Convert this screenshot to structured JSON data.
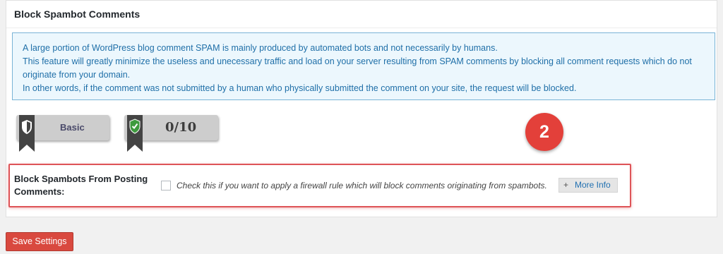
{
  "panel": {
    "title": "Block Spambot Comments",
    "info_lines": [
      "A large portion of WordPress blog comment SPAM is mainly produced by automated bots and not necessarily by humans.",
      "This feature will greatly minimize the useless and unecessary traffic and load on your server resulting from SPAM comments by blocking all comment requests which do not originate from your domain.",
      "In other words, if the comment was not submitted by a human who physically submitted the comment on your site, the request will be blocked."
    ]
  },
  "badges": {
    "level_label": "Basic",
    "score_label": "0/10"
  },
  "step_marker": "2",
  "setting": {
    "label": "Block Spambots From Posting Comments:",
    "description": "Check this if you want to apply a firewall rule which will block comments originating from spambots.",
    "checked": false,
    "more_info_plus": "+",
    "more_info_label": "More Info"
  },
  "actions": {
    "save_label": "Save Settings"
  },
  "colors": {
    "accent_red": "#d9493f",
    "info_blue": "#1f6fa8",
    "highlight_border": "#de5458"
  }
}
